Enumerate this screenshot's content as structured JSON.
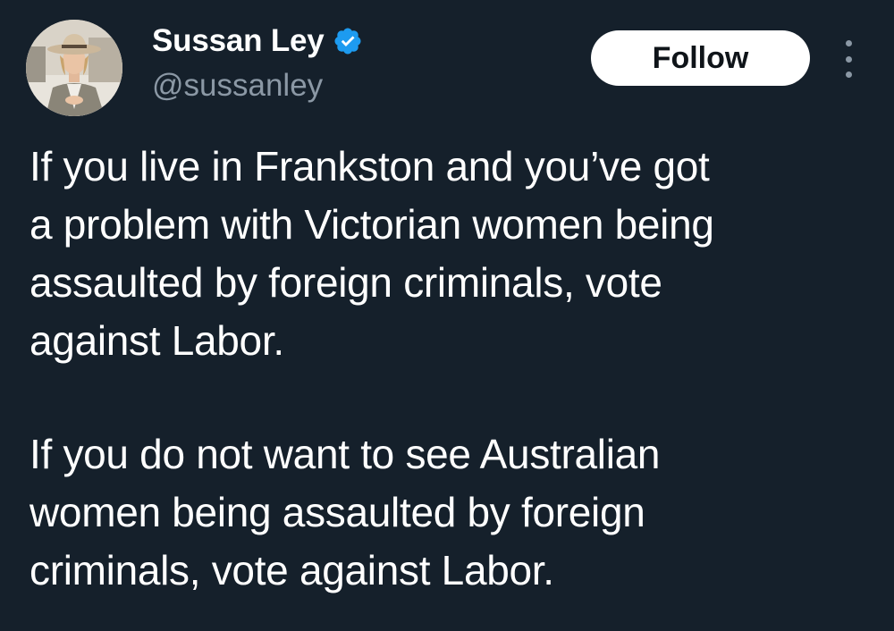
{
  "author": {
    "display_name": "Sussan Ley",
    "handle": "@sussanley",
    "verified": true,
    "verified_color": "#1d9bf0"
  },
  "actions": {
    "follow_label": "Follow",
    "more_icon": "more-vertical-icon"
  },
  "tweet": {
    "paragraphs": [
      {
        "lines": [
          "If you live in Frankston and you’ve got",
          "a problem with Victorian women being",
          "assaulted by foreign criminals, vote",
          "against Labor."
        ]
      },
      {
        "lines": [
          "If you do not want to see Australian",
          "women being assaulted by foreign",
          "criminals, vote against Labor."
        ]
      }
    ]
  },
  "theme": {
    "background": "#15202b",
    "text": "#ffffff",
    "secondary_text": "#8b98a5",
    "follow_button_bg": "#ffffff"
  }
}
